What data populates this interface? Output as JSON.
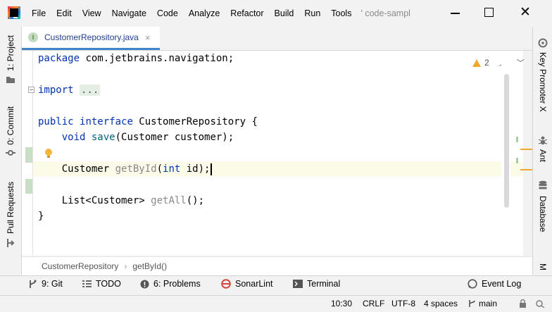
{
  "menu": [
    "File",
    "Edit",
    "View",
    "Navigate",
    "Code",
    "Analyze",
    "Refactor",
    "Build",
    "Run",
    "Tools",
    "' code-sampl"
  ],
  "left_tabs": {
    "project": "1: Project",
    "commit": "0: Commit",
    "pull_requests": "Pull Requests"
  },
  "right_tabs": {
    "key_promoter": "Key Promoter X",
    "ant": "Ant",
    "database": "Database",
    "m": "M"
  },
  "tab": {
    "icon_letter": "I",
    "name": "CustomerRepository.java",
    "close": "×"
  },
  "inspection": {
    "warnings": "2"
  },
  "code": {
    "l1": {
      "kw": "package",
      "rest": " com.jetbrains.navigation;"
    },
    "l2": {
      "kw": "import",
      "fold": "..."
    },
    "l3": {
      "kw1": "public",
      "kw2": "interface",
      "name": " CustomerRepository {"
    },
    "l4": {
      "kw": "void",
      "fn": "save",
      "rest": "(Customer customer);"
    },
    "l5": {
      "type": "Customer ",
      "fn": "getById",
      "open": "(",
      "kw": "int",
      "rest": " id);"
    },
    "l6": {
      "type": "List<Customer> ",
      "fn": "getAll",
      "rest": "();"
    },
    "l7": "}"
  },
  "breadcrumb": [
    "CustomerRepository",
    "getById()"
  ],
  "toolwindows": {
    "git": "9: Git",
    "todo": "TODO",
    "problems": "6: Problems",
    "sonarlint": "SonarLint",
    "terminal": "Terminal",
    "eventlog": "Event Log"
  },
  "status": {
    "time": "10:30",
    "line_sep": "CRLF",
    "encoding": "UTF-8",
    "indent": "4 spaces",
    "branch": "main"
  },
  "colors": {
    "accent": "#4083c9",
    "keyword": "#0033b3",
    "function": "#00627a",
    "warning": "#f0a732",
    "change": "#c9dfc5"
  }
}
